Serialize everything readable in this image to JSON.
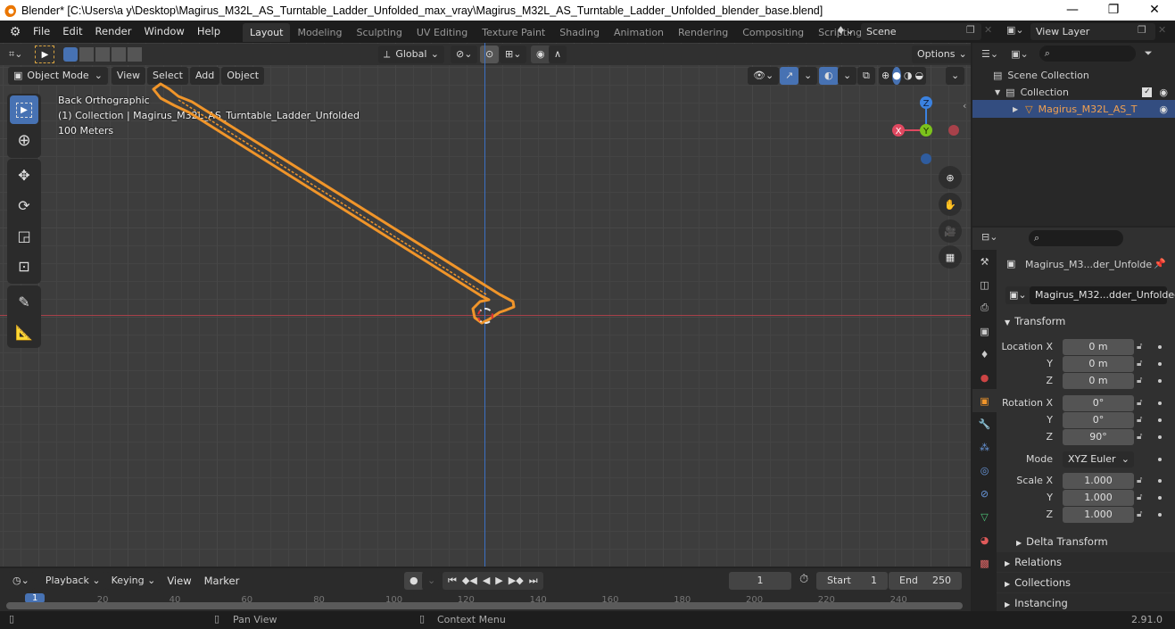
{
  "window": {
    "title": "Blender* [C:\\Users\\a y\\Desktop\\Magirus_M32L_AS_Turntable_Ladder_Unfolded_max_vray\\Magirus_M32L_AS_Turntable_Ladder_Unfolded_blender_base.blend]",
    "minimize": "—",
    "restore": "❐",
    "close": "✕"
  },
  "menu": [
    "File",
    "Edit",
    "Render",
    "Window",
    "Help"
  ],
  "workspaces": [
    {
      "label": "Layout",
      "active": true
    },
    {
      "label": "Modeling"
    },
    {
      "label": "Sculpting"
    },
    {
      "label": "UV Editing"
    },
    {
      "label": "Texture Paint"
    },
    {
      "label": "Shading"
    },
    {
      "label": "Animation"
    },
    {
      "label": "Rendering"
    },
    {
      "label": "Compositing"
    },
    {
      "label": "Scripting"
    }
  ],
  "add_workspace": "+",
  "scene": {
    "name": "Scene",
    "view_layer": "View Layer"
  },
  "viewport": {
    "transform_orientation": "Global",
    "options_label": "Options",
    "mode": "Object Mode",
    "menus": [
      "View",
      "Select",
      "Add",
      "Object"
    ],
    "overlay": {
      "view_name": "Back Orthographic",
      "collection_info": "(1) Collection | Magirus_M32L_AS_Turntable_Ladder_Unfolded",
      "scale": "100 Meters"
    },
    "gizmo": {
      "z": "Z",
      "x": "X",
      "y": "Y"
    },
    "colors": {
      "selection": "#f0952a",
      "x_axis": "#a8414a",
      "z_axis": "#3b70c4",
      "active_tool": "#4772b3"
    }
  },
  "outliner": {
    "search_placeholder": "",
    "scene_collection": "Scene Collection",
    "collection": "Collection",
    "object": "Magirus_M32L_AS_T"
  },
  "properties": {
    "search_placeholder": "",
    "object_name_short": "Magirus_M3...der_Unfolde",
    "object_datablock": "Magirus_M32...dder_Unfolded",
    "transform_header": "Transform",
    "location": {
      "label": "Location X",
      "x": "0 m",
      "y": "0 m",
      "z": "0 m"
    },
    "rotation": {
      "label": "Rotation X",
      "x": "0°",
      "y": "0°",
      "z": "90°"
    },
    "mode_label": "Mode",
    "mode_value": "XYZ Euler",
    "scale": {
      "label": "Scale X",
      "x": "1.000",
      "y": "1.000",
      "z": "1.000"
    },
    "axis_y": "Y",
    "axis_z": "Z",
    "subpanels": [
      "Delta Transform",
      "Relations",
      "Collections",
      "Instancing"
    ]
  },
  "timeline": {
    "menus": [
      "Playback",
      "Keying",
      "View",
      "Marker"
    ],
    "current_frame": "1",
    "start_label": "Start",
    "start": "1",
    "end_label": "End",
    "end": "250",
    "ticks": [
      "1",
      "20",
      "40",
      "60",
      "80",
      "100",
      "120",
      "140",
      "160",
      "180",
      "200",
      "220",
      "240"
    ]
  },
  "statusbar": {
    "pan": "Pan View",
    "context": "Context Menu",
    "version": "2.91.0"
  }
}
